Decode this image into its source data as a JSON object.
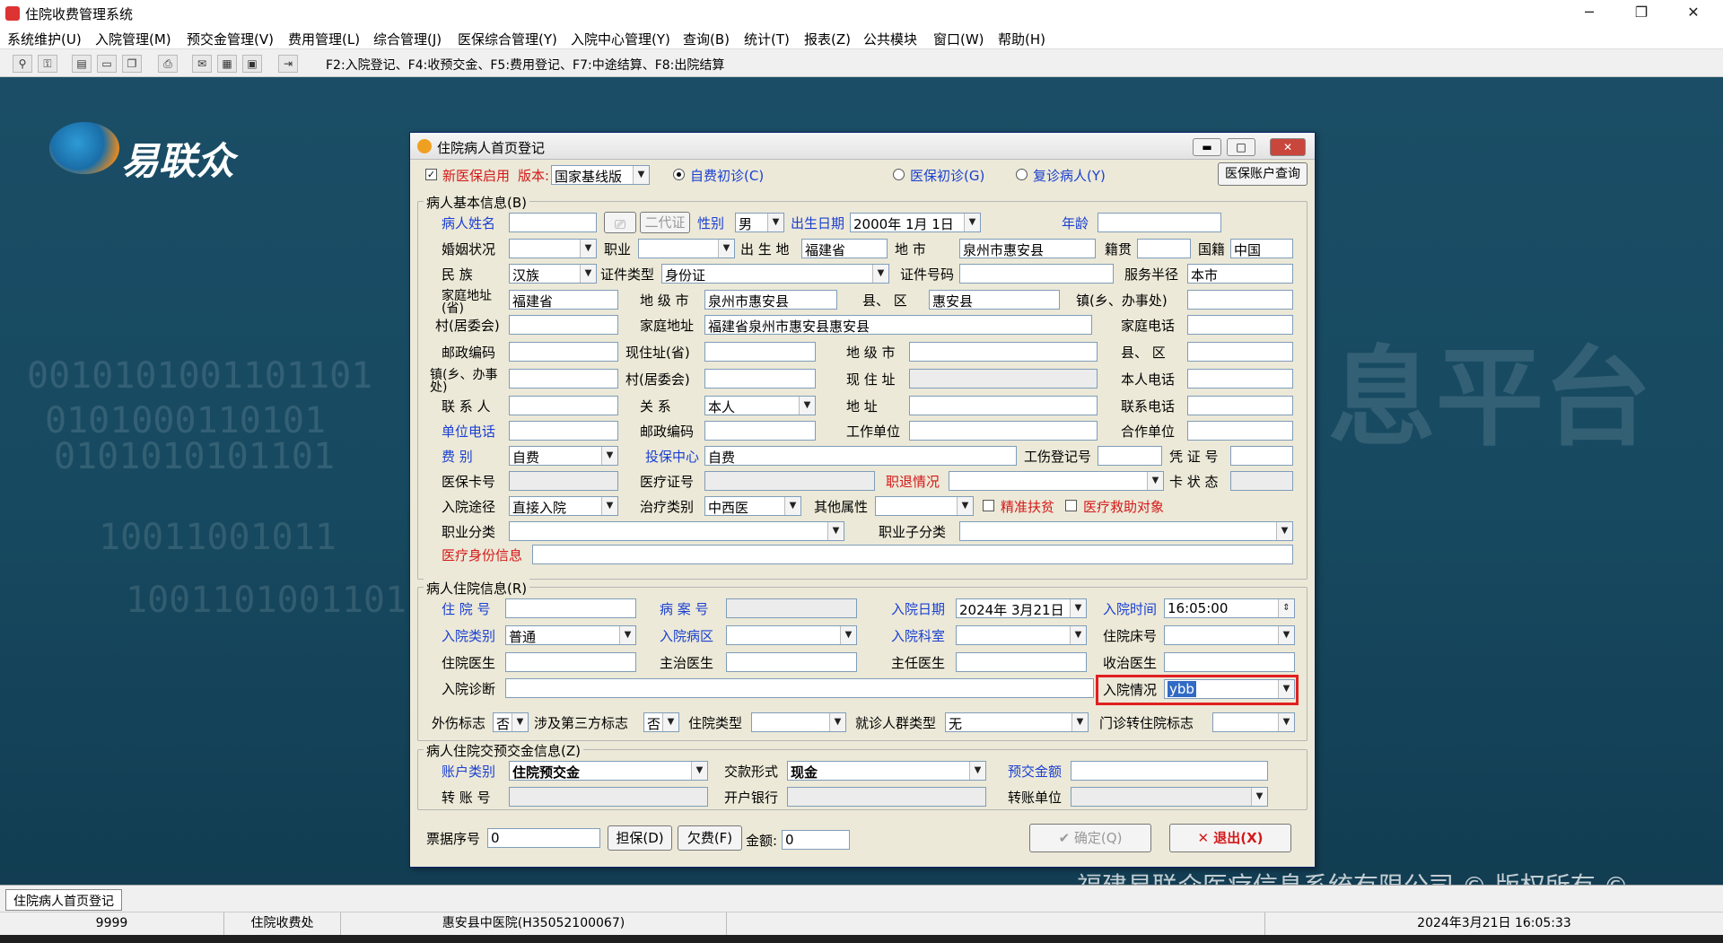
{
  "window": {
    "title": "住院收费管理系统",
    "min": "─",
    "restore": "❐",
    "close": "✕"
  },
  "menu": [
    "系统维护(U)",
    "入院管理(M)",
    "预交金管理(V)",
    "费用管理(L)",
    "综合管理(J)",
    "医保综合管理(Y)",
    "入院中心管理(Y)",
    "查询(B)",
    "统计(T)",
    "报表(Z)",
    "公共模块",
    "窗口(W)",
    "帮助(H)"
  ],
  "toolbar": {
    "hint": "F2:入院登记、F4:收预交金、F5:费用登记、F7:中途结算、F8:出院结算"
  },
  "desktop": {
    "logo_text": "易联众",
    "bg_text": "息平台",
    "copyright": "福建易联众医疗信息系统有限公司 © 版权所有 ©",
    "binary": [
      "0010101001101101",
      "0101000110101",
      "0101010101101",
      "10011001011",
      "1001101001101"
    ]
  },
  "dialog": {
    "title": "住院病人首页登记",
    "top": {
      "new_insurance": "新医保启用",
      "version_label": "版本:",
      "version": "国家基线版",
      "self_pay": "自费初诊(C)",
      "ins_first": "医保初诊(G)",
      "revisit": "复诊病人(Y)",
      "account_query": "医保账户查询"
    },
    "basic": {
      "legend": "病人基本信息(B)",
      "name": "病人姓名",
      "id2": "二代证",
      "sex": "性别",
      "sex_val": "男",
      "dob": "出生日期",
      "dob_val": "2000年 1月 1日",
      "age": "年龄",
      "marital": "婚姻状况",
      "job": "职业",
      "birthplace": "出 生 地",
      "birthplace_val": "福建省",
      "city": "地 市",
      "city_val": "泉州市惠安县",
      "native": "籍贯",
      "nation": "国籍",
      "nation_val": "中国",
      "ethnic": "民 族",
      "ethnic_val": "汉族",
      "idtype": "证件类型",
      "idtype_val": "身份证",
      "idno": "证件号码",
      "radius": "服务半径",
      "radius_val": "本市",
      "home_prov": "家庭地址(省)",
      "home_prov_val": "福建省",
      "home_city": "地 级 市",
      "home_city_val": "泉州市惠安县",
      "county": "县、 区",
      "county_val": "惠安县",
      "town": "镇(乡、办事处)",
      "village": "村(居委会)",
      "home_addr": "家庭地址",
      "home_addr_val": "福建省泉州市惠安县惠安县",
      "home_phone": "家庭电话",
      "postcode": "邮政编码",
      "cur_prov": "现住址(省)",
      "cur_city": "地 级 市",
      "cur_county": "县、 区",
      "cur_town": "镇(乡、办事处)",
      "cur_village": "村(居委会)",
      "cur_addr": "现 住 址",
      "my_phone": "本人电话",
      "contact": "联 系 人",
      "relation": "关 系",
      "relation_val": "本人",
      "addr": "地 址",
      "contact_phone": "联系电话",
      "unit_phone": "单位电话",
      "postcode2": "邮政编码",
      "work_unit": "工作单位",
      "coop_unit": "合作单位",
      "fee_type": "费 别",
      "fee_type_val": "自费",
      "ins_center": "投保中心",
      "ins_center_val": "自费",
      "injury_no": "工伤登记号",
      "voucher": "凭 证 号",
      "ins_card": "医保卡号",
      "med_cert": "医疗证号",
      "retire": "职退情况",
      "card_state": "卡 状 态",
      "admit_way": "入院途径",
      "admit_way_val": "直接入院",
      "treat_type": "治疗类别",
      "treat_type_val": "中西医",
      "other_attr": "其他属性",
      "poverty": "精准扶贫",
      "relief": "医疗救助对象",
      "job_class": "职业分类",
      "job_sub": "职业子分类",
      "med_identity": "医疗身份信息"
    },
    "inpatient": {
      "legend": "病人住院信息(R)",
      "hosp_no": "住 院 号",
      "case_no": "病 案 号",
      "admit_date": "入院日期",
      "admit_date_val": "2024年 3月21日",
      "admit_time": "入院时间",
      "admit_time_val": "16:05:00",
      "admit_kind": "入院类别",
      "admit_kind_val": "普通",
      "ward": "入院病区",
      "dept": "入院科室",
      "bed": "住院床号",
      "doctor": "住院医生",
      "attending": "主治医生",
      "chief": "主任医生",
      "receiver": "收治医生",
      "diagnosis": "入院诊断",
      "condition": "入院情况",
      "condition_val": "ybb",
      "trauma": "外伤标志",
      "trauma_val": "否",
      "third": "涉及第三方标志",
      "third_val": "否",
      "hosp_type": "住院类型",
      "crowd": "就诊人群类型",
      "crowd_val": "无",
      "outpatient": "门诊转住院标志"
    },
    "deposit": {
      "legend": "病人住院交预交金信息(Z)",
      "acct_type": "账户类别",
      "acct_type_val": "住院预交金",
      "pay_form": "交款形式",
      "pay_form_val": "现金",
      "amount": "预交金额",
      "transfer_no": "转 账 号",
      "bank": "开户银行",
      "transfer_unit": "转账单位"
    },
    "bottom": {
      "receipt": "票据序号",
      "receipt_val": "0",
      "guarantee": "担保(D)",
      "arrears": "欠费(F)",
      "money": "金额:",
      "money_val": "0",
      "ok": "确定(Q)",
      "exit": "退出(X)"
    }
  },
  "tabs": {
    "active": "住院病人首页登记"
  },
  "status": {
    "user": "9999",
    "dept": "住院收费处",
    "hospital": "惠安县中医院(H35052100067)",
    "time": "2024年3月21日 16:05:33"
  }
}
